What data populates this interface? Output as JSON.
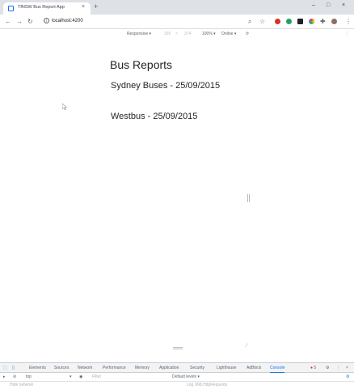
{
  "browser": {
    "tab_title": "TfNSW Bus Report App",
    "tab_close": "×",
    "new_tab": "+",
    "url": "localhost:4200",
    "window_controls": {
      "minimize": "–",
      "maximize": "□",
      "close": "×"
    }
  },
  "device_toolbar": {
    "device": "Responsive ▾",
    "width": "335",
    "times": "×",
    "height": "374",
    "zoom": "100% ▾",
    "network": "Online ▾"
  },
  "page": {
    "title": "Bus Reports",
    "reports": [
      {
        "label": "Sydney Buses - 25/09/2015"
      },
      {
        "label": "Westbus - 25/09/2015"
      }
    ]
  },
  "devtools": {
    "tabs": [
      "Elements",
      "Sources",
      "Network",
      "Performance",
      "Memory",
      "Application",
      "Security",
      "Lighthouse",
      "AdBlock",
      "Console"
    ],
    "active_tab": "Console",
    "error_count": "5",
    "context": "top",
    "filter_placeholder": "Filter",
    "levels": "Default levels ▾",
    "hide_network": "Hide network",
    "log_xhr": "Log XMLHttpRequests"
  },
  "colors": {
    "accent": "#1a73e8",
    "text": "#212529",
    "error": "#d93025"
  }
}
